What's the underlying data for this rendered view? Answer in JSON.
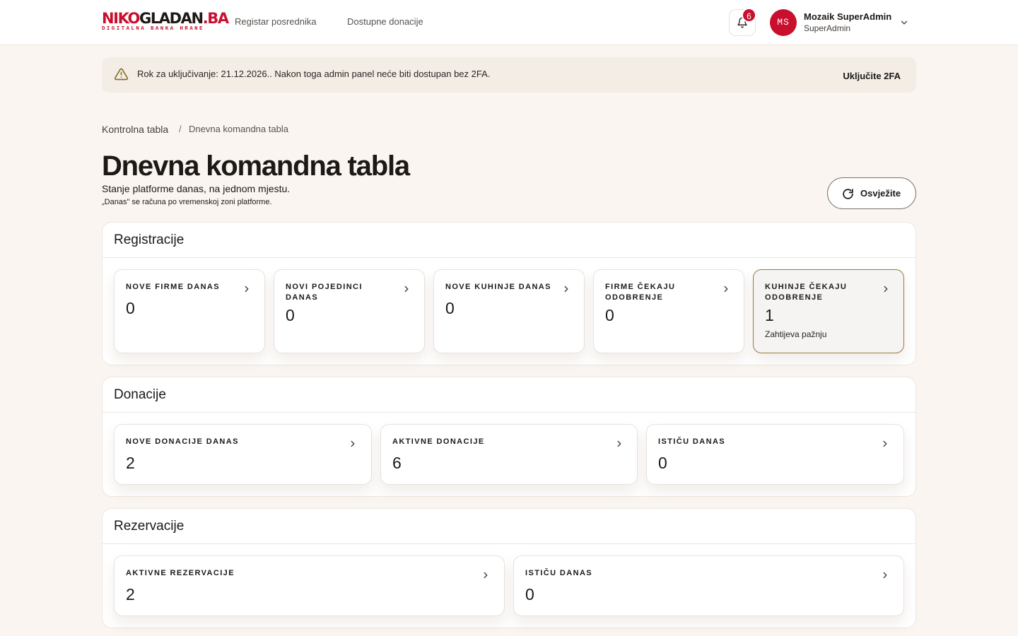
{
  "header": {
    "logo_a": "NIKO",
    "logo_b": "GLADAN",
    "logo_c": ".BA",
    "logo_sub": "DIGITALNA BANKA HRANE",
    "nav": [
      "Registar posrednika",
      "Dostupne donacije"
    ],
    "notifications_count": "6",
    "user_initials": "MS",
    "user_name": "Mozaik SuperAdmin",
    "user_role": "SuperAdmin"
  },
  "banner": {
    "text": "Rok za uključivanje: 21.12.2026.. Nakon toga admin panel neće biti dostupan bez 2FA.",
    "action": "Uključite 2FA"
  },
  "breadcrumb": {
    "root": "Kontrolna tabla",
    "separator": "/",
    "current": "Dnevna komandna tabla"
  },
  "page": {
    "title": "Dnevna komandna tabla",
    "subtitle": "Stanje platforme danas, na jednom mjestu.",
    "note": "„Danas\" se računa po vremenskoj zoni platforme.",
    "refresh_label": "Osvježite"
  },
  "sections": {
    "registracije": {
      "title": "Registracije",
      "tiles": [
        {
          "label": "NOVE FIRME DANAS",
          "value": "0"
        },
        {
          "label": "NOVI POJEDINCI DANAS",
          "value": "0"
        },
        {
          "label": "NOVE KUHINJE DANAS",
          "value": "0"
        },
        {
          "label": "FIRME ČEKAJU ODOBRENJE",
          "value": "0"
        },
        {
          "label": "KUHINJE ČEKAJU ODOBRENJE",
          "value": "1",
          "hint": "Zahtijeva pažnju"
        }
      ]
    },
    "donacije": {
      "title": "Donacije",
      "tiles": [
        {
          "label": "NOVE DONACIJE DANAS",
          "value": "2"
        },
        {
          "label": "AKTIVNE DONACIJE",
          "value": "6"
        },
        {
          "label": "ISTIČU DANAS",
          "value": "0"
        }
      ]
    },
    "rezervacije": {
      "title": "Rezervacije",
      "tiles": [
        {
          "label": "AKTIVNE REZERVACIJE",
          "value": "2"
        },
        {
          "label": "ISTIČU DANAS",
          "value": "0"
        }
      ]
    }
  },
  "colors": {
    "brand": "#c8102e",
    "background": "#faf5f0",
    "attention_border": "#9a7b3a"
  },
  "icons": [
    "bell-icon",
    "chevron-down-icon",
    "warning-icon",
    "refresh-icon",
    "chevron-right-icon"
  ]
}
